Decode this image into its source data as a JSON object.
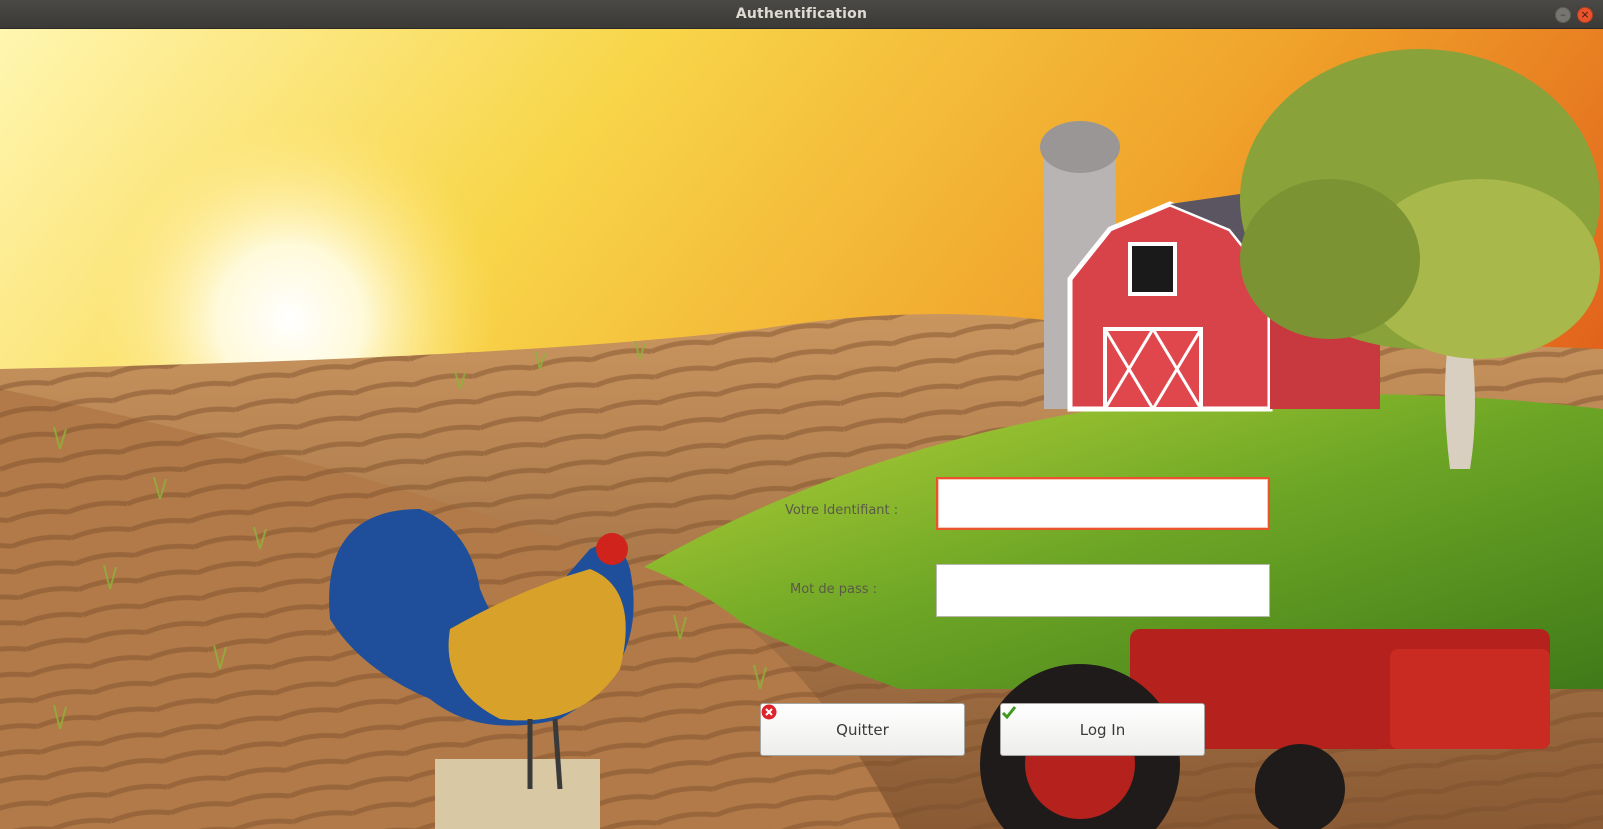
{
  "window": {
    "title": "Authentification",
    "minimize_glyph": "–",
    "close_glyph": "×"
  },
  "form": {
    "identifiant_label": "Votre Identifiant :",
    "identifiant_value": "",
    "password_label": "Mot de pass :",
    "password_value": ""
  },
  "buttons": {
    "quit_label": "Quitter",
    "quit_icon": "red-cancel-icon",
    "login_label": "Log In",
    "login_icon": "green-check-icon"
  },
  "colors": {
    "accent": "#e9542d",
    "title_bar": "#3b3a37"
  }
}
